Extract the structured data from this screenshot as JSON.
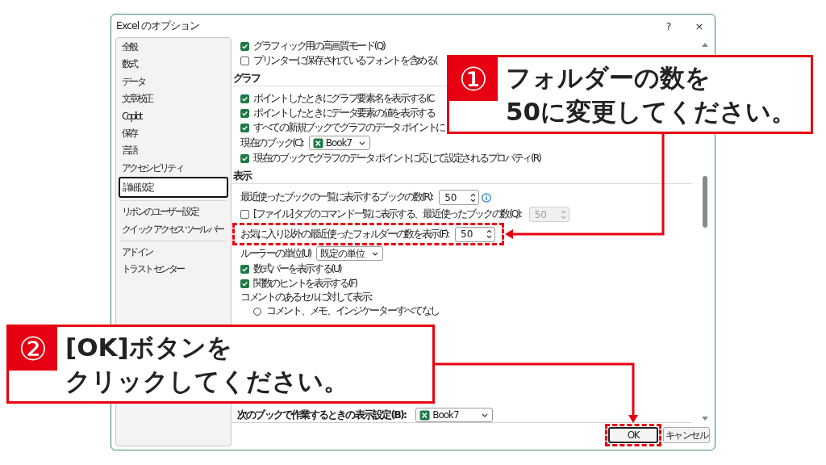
{
  "window": {
    "title": "Excel のオプション",
    "help": "?",
    "close": "×"
  },
  "sidebar": {
    "groups": [
      {
        "items": [
          {
            "label": "全般",
            "selected": false
          },
          {
            "label": "数式",
            "selected": false
          },
          {
            "label": "データ",
            "selected": false
          },
          {
            "label": "文章校正",
            "selected": false
          },
          {
            "label": "Copilot",
            "selected": false
          },
          {
            "label": "保存",
            "selected": false
          },
          {
            "label": "言語",
            "selected": false
          },
          {
            "label": "アクセシビリティ",
            "selected": false
          },
          {
            "label": "詳細設定",
            "selected": true
          }
        ]
      },
      {
        "items": [
          {
            "label": "リボンのユーザー設定",
            "selected": false
          },
          {
            "label": "クイック アクセス ツール バー",
            "selected": false
          }
        ]
      },
      {
        "items": [
          {
            "label": "アドイン",
            "selected": false
          },
          {
            "label": "トラスト センター",
            "selected": false
          }
        ]
      }
    ]
  },
  "content": {
    "rows": [
      {
        "kind": "checkbox",
        "label": "グラフィック用の高画質モード(Q)",
        "checked": true
      },
      {
        "kind": "checkbox",
        "label": "プリンターに保存されているフォントを含める(",
        "checked": false
      },
      {
        "kind": "section",
        "label": "グラフ"
      },
      {
        "kind": "checkbox",
        "label": "ポイントしたときにグラフ要素名を表示する(C",
        "checked": true
      },
      {
        "kind": "checkbox",
        "label": "ポイントしたときにデータ要素の値を表示する",
        "checked": true
      },
      {
        "kind": "checkbox",
        "label": "すべての新規ブックでグラフのデータ ポイントに",
        "checked": true
      },
      {
        "kind": "dropdown",
        "label": "現在のブック(C):",
        "value": "Book7",
        "workbook_icon": true
      },
      {
        "kind": "checkbox",
        "label": "現在のブックでグラフのデータ ポイントに応じて設定されるプロパティ(R)",
        "checked": true
      },
      {
        "kind": "section",
        "label": "表示"
      },
      {
        "kind": "spinner",
        "label": "最近使ったブックの一覧に表示するブックの数(R):",
        "value": "50",
        "info": true
      },
      {
        "kind": "spinner",
        "label": "[ファイル] タブのコマンド一覧に表示する、最近使ったブックの数(Q):",
        "checked": false,
        "value": "50",
        "disabled": true
      },
      {
        "kind": "spinner",
        "label": "お気に入り以外の最近使ったフォルダーの数を表示(F):",
        "value": "50",
        "highlight": true
      },
      {
        "kind": "dropdown",
        "label": "ルーラーの単位(U)",
        "value": "既定の単位"
      },
      {
        "kind": "checkbox",
        "label": "数式バーを表示する(U)",
        "checked": true
      },
      {
        "kind": "checkbox",
        "label": "関数のヒントを表示する(F)",
        "checked": true
      },
      {
        "kind": "text",
        "label": "コメントのあるセルに対して表示:"
      },
      {
        "kind": "radio",
        "label": "コメント、メモ、インジケーターすべてなし",
        "selected": false
      }
    ],
    "bottom_row": {
      "kind": "dropdown",
      "label": "次のブックで作業するときの表示設定(B):",
      "value": "Book7",
      "workbook_icon": true
    }
  },
  "buttons": [
    {
      "label": "OK",
      "default": true,
      "highlight": true
    },
    {
      "label": "キャンセル",
      "default": false,
      "highlight": false
    }
  ],
  "callouts": [
    {
      "number": "①",
      "lines": [
        "フォルダーの数を",
        "50に変更してください。"
      ],
      "arrow": true
    },
    {
      "number": "②",
      "lines": [
        "[OK]ボタンを",
        "クリックしてください。"
      ],
      "arrow": true
    }
  ]
}
